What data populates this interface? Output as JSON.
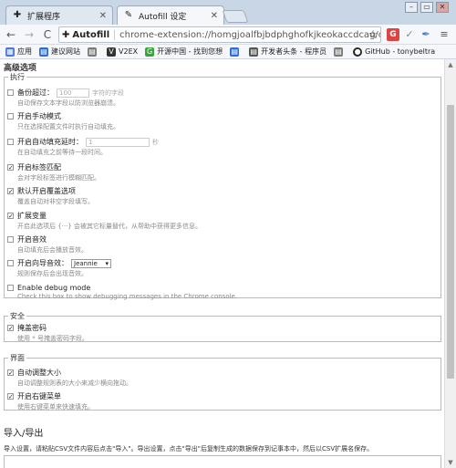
{
  "tabs": [
    {
      "title": "扩展程序",
      "icon": "puzzle-icon",
      "close": "✕"
    },
    {
      "title": "Autofill 设定",
      "icon": "autofill-icon",
      "close": "✕"
    }
  ],
  "window_controls": {
    "minimize": "–",
    "restore": "▭",
    "close": "✕"
  },
  "toolbar": {
    "back": "←",
    "forward": "→",
    "reload": "C",
    "ext_name": "Autofill",
    "url": "chrome-extension://homgjoalfbjbdphghofkjkeokaccdcag/opt",
    "star": "☆"
  },
  "bookmarks": [
    {
      "label": "应用",
      "color": "#4a7bd0"
    },
    {
      "label": "建议网站",
      "color": "#2b6fd6"
    },
    {
      "label": "",
      "color": "#7a7a7a"
    },
    {
      "label": "V2EX",
      "color": "#333333"
    },
    {
      "label": "开源中国 - 找到您想",
      "color": "#3aa63a"
    },
    {
      "label": "",
      "color": "#2b6fd6"
    },
    {
      "label": "开发者头条 - 程序员",
      "color": "#333333"
    },
    {
      "label": "",
      "color": "#7a7a7a"
    },
    {
      "label": "GitHub - tonybeltra",
      "color": "#222222"
    }
  ],
  "advanced": {
    "title": "高级选项",
    "legend": "执行",
    "options": [
      {
        "label": "备份超过：",
        "input_value": "100",
        "suffix": "字符的字段",
        "desc": "自动保存文本字段以防浏览器崩溃。",
        "checked": false,
        "muted": false
      },
      {
        "label": "开启手动模式",
        "desc": "只在选择配置文件时执行自动填充。",
        "checked": false
      },
      {
        "label": "开启自动填充延时：",
        "input_value": "1",
        "suffix": "秒",
        "desc": "在自动填充之前等待一段时间。",
        "checked": false
      },
      {
        "label": "开启标签匹配",
        "desc": "会对字段标签进行模糊匹配。",
        "checked": true
      },
      {
        "label": "默认开启覆盖选项",
        "desc": "覆盖自动对非空字段填写。",
        "checked": true
      },
      {
        "label": "扩展变量",
        "desc": "开启此选项后 {···} 会被其它标量替代，从帮助中获得更多信息。",
        "checked": true
      },
      {
        "label": "开启音效",
        "desc": "自动填充后会播放音效。",
        "checked": false
      },
      {
        "label": "开启向导音效：",
        "select_value": "Jeannie",
        "desc": "规则保存后会出现音效。",
        "checked": false
      },
      {
        "label": "Enable debug mode",
        "desc": "Check this box to show debugging messages in the Chrome console.",
        "checked": false
      }
    ]
  },
  "security": {
    "legend": "安全",
    "options": [
      {
        "label": "掩盖密码",
        "desc": "使用 * 号掩盖密码字段。",
        "checked": true
      }
    ]
  },
  "interface": {
    "legend": "界面",
    "options": [
      {
        "label": "自动调整大小",
        "desc": "自动调整规则表的大小来减少横向拖动。",
        "checked": true
      },
      {
        "label": "开启右键菜单",
        "desc": "使用右键菜单来快速填充。",
        "checked": true
      }
    ]
  },
  "import_export": {
    "heading": "导入/导出",
    "text": "导入设置，请粘贴CSV文件内容后点击\"导入\"。导出设置，点击\"导出\"后复制生成的数据保存到记事本中，然后以CSV扩展名保存。"
  },
  "colors": {
    "tabstrip": "#c9d6e6",
    "check": "#222222",
    "muted": "#8a8a8a"
  }
}
